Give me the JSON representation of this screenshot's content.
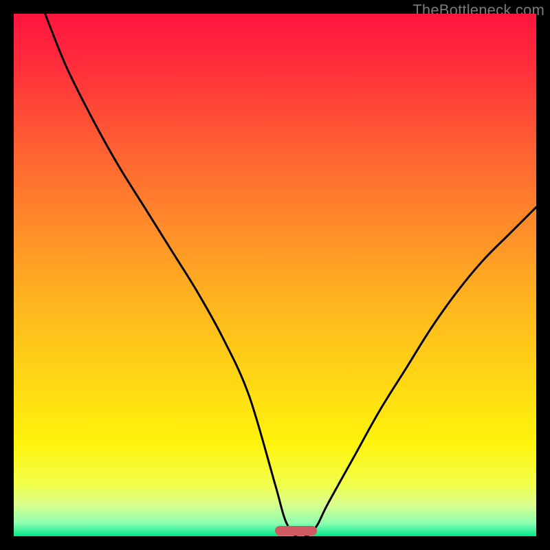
{
  "watermark": {
    "text": "TheBottleneck.com"
  },
  "colors": {
    "black": "#000000",
    "curve_stroke": "#000000",
    "pill": "#cf5a61",
    "gradient_stops": [
      {
        "offset": 0.0,
        "color": "#ff153e"
      },
      {
        "offset": 0.1,
        "color": "#ff2e3b"
      },
      {
        "offset": 0.25,
        "color": "#ff5e33"
      },
      {
        "offset": 0.4,
        "color": "#ff8a2a"
      },
      {
        "offset": 0.55,
        "color": "#ffb41f"
      },
      {
        "offset": 0.7,
        "color": "#ffd714"
      },
      {
        "offset": 0.82,
        "color": "#fff30a"
      },
      {
        "offset": 0.9,
        "color": "#f2ff4a"
      },
      {
        "offset": 0.94,
        "color": "#d8ff8f"
      },
      {
        "offset": 0.975,
        "color": "#8cffb0"
      },
      {
        "offset": 1.0,
        "color": "#00e88a"
      }
    ]
  },
  "chart_data": {
    "type": "line",
    "title": "",
    "xlabel": "",
    "ylabel": "",
    "xlim": [
      0,
      100
    ],
    "ylim": [
      0,
      100
    ],
    "pill_marker": {
      "x_start": 50,
      "x_end": 58,
      "y": 1
    },
    "series": [
      {
        "name": "bottleneck-curve",
        "x": [
          6,
          10,
          15,
          20,
          25,
          30,
          35,
          40,
          45,
          50,
          52,
          54,
          56,
          58,
          60,
          65,
          70,
          75,
          80,
          85,
          90,
          95,
          100
        ],
        "y": [
          100,
          90,
          80,
          71,
          63,
          55,
          47,
          38,
          27,
          10,
          3,
          0,
          0,
          2,
          6,
          15,
          24,
          32,
          40,
          47,
          53,
          58,
          63
        ]
      }
    ]
  }
}
